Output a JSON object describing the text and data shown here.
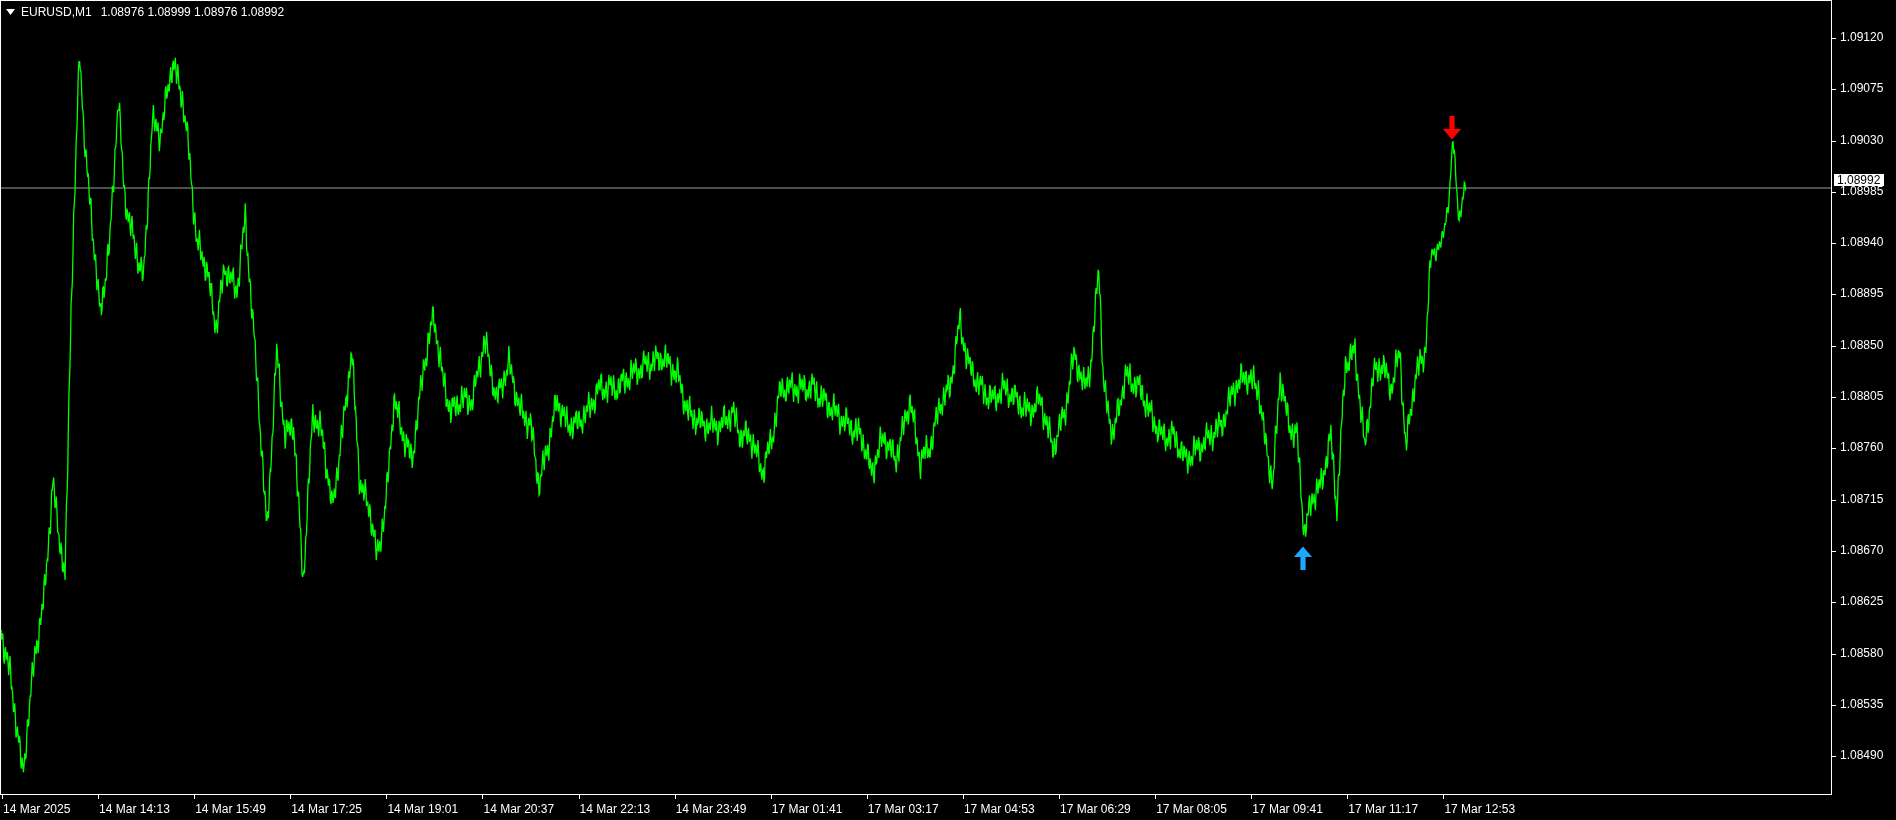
{
  "chart": {
    "symbol": "EURUSD,M1",
    "quote": "1.08976 1.08999 1.08976 1.08992",
    "current_price": "1.08992",
    "price_ticks": [
      "1.09120",
      "1.09075",
      "1.09030",
      "1.08985",
      "1.08940",
      "1.08895",
      "1.08850",
      "1.08805",
      "1.08760",
      "1.08715",
      "1.08670",
      "1.08625",
      "1.08580",
      "1.08535",
      "1.08490"
    ],
    "time_ticks": [
      "14 Mar 2025",
      "14 Mar 14:13",
      "14 Mar 15:49",
      "14 Mar 17:25",
      "14 Mar 19:01",
      "14 Mar 20:37",
      "14 Mar 22:13",
      "14 Mar 23:49",
      "17 Mar 01:41",
      "17 Mar 03:17",
      "17 Mar 04:53",
      "17 Mar 06:29",
      "17 Mar 08:05",
      "17 Mar 09:41",
      "17 Mar 11:17",
      "17 Mar 12:53"
    ],
    "signals": [
      {
        "kind": "sell"
      },
      {
        "kind": "buy"
      }
    ]
  }
}
